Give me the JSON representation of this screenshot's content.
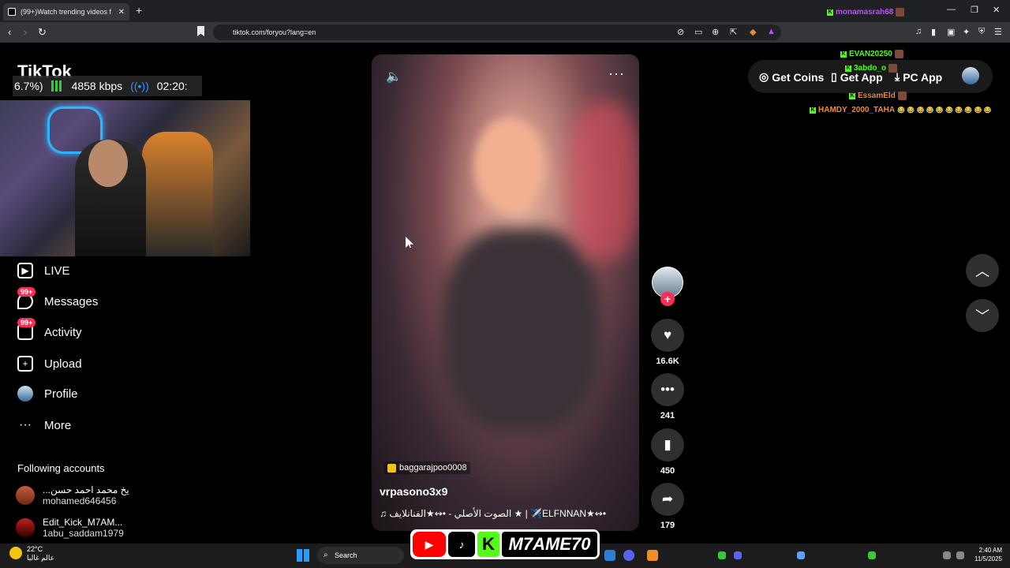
{
  "browser": {
    "tab_title": "(99+)Watch trending videos f",
    "url": "tiktok.com/foryou?lang=en",
    "new_tab": "+",
    "tab_close": "✕"
  },
  "stream_stats": {
    "percent": "6.7%)",
    "bitrate": "4858 kbps",
    "time": "02:20:"
  },
  "tiktok": {
    "logo": "TikTok",
    "nav": [
      {
        "label": "LIVE",
        "icon": "live-icon"
      },
      {
        "label": "Messages",
        "icon": "messages-icon",
        "badge": "99+"
      },
      {
        "label": "Activity",
        "icon": "activity-icon",
        "badge": "99+"
      },
      {
        "label": "Upload",
        "icon": "upload-icon"
      },
      {
        "label": "Profile",
        "icon": "profile-icon"
      },
      {
        "label": "More",
        "icon": "more-icon"
      }
    ],
    "following_title": "Following accounts",
    "following": [
      {
        "name": "...يخ محمد احمد حسن",
        "user": "mohamed646456"
      },
      {
        "name": "Edit_Kick_M7AM...",
        "user": "1abu_saddam1979"
      }
    ],
    "header": {
      "get_coins": "Get Coins",
      "get_app": "Get App",
      "pc_app": "PC App"
    },
    "video": {
      "tag": "baggarajpoo0008",
      "username": "vrpasono3x9",
      "music": "♫  الصوت الأصلي - •↭★الفنانلايف ★ | ✈️ELFNNAN★↭•"
    },
    "actions": {
      "likes": "16.6K",
      "comments": "241",
      "saves": "450",
      "shares": "179"
    }
  },
  "chat": [
    {
      "user": "monamasrah68",
      "color": "#c04cff"
    },
    {
      "user": "EVAN20250",
      "color": "#53fc18"
    },
    {
      "user": "3abdo_o",
      "color": "#53fc18"
    },
    {
      "user": "EssamEld",
      "color": "#f28c28"
    },
    {
      "user": "HAMDY_2000_TAHA",
      "color": "#f28c28",
      "emotes": "😂 😂 😂 😂 😂 😂 😂 😂 😂 😂"
    }
  ],
  "taskbar": {
    "temperature": "22°C",
    "weather_text": "عالم غالبا",
    "search": "Search",
    "time": "2:40 AM",
    "date": "11/5/2025"
  },
  "brand": {
    "name": "M7AME70",
    "tiktok_label": "TikTok"
  }
}
